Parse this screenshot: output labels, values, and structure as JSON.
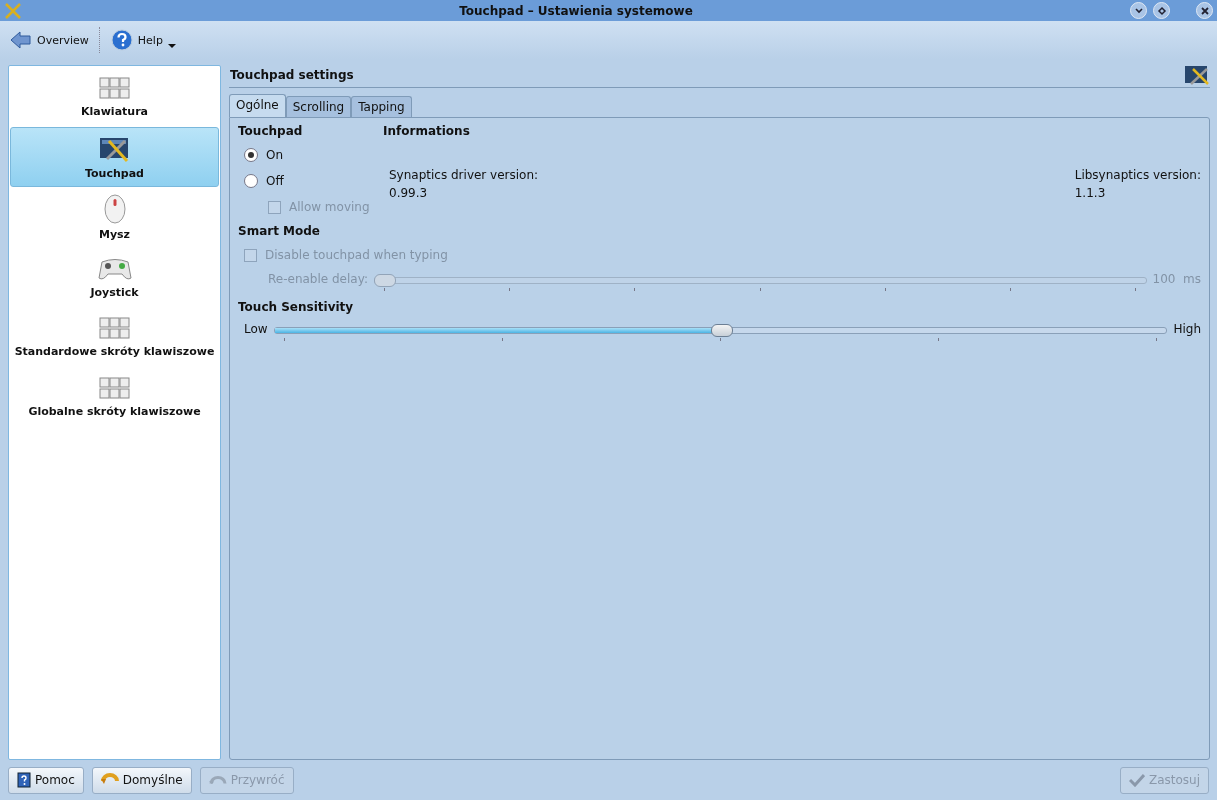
{
  "window": {
    "title": "Touchpad – Ustawienia systemowe"
  },
  "toolbar": [
    {
      "kind": "back",
      "label": "Overview"
    },
    {
      "kind": "help",
      "label": "Help",
      "menu": true
    }
  ],
  "sidebar": {
    "items": [
      {
        "kind": "keyboard",
        "label": "Klawiatura",
        "selected": false
      },
      {
        "kind": "touchpad",
        "label": "Touchpad",
        "selected": true
      },
      {
        "kind": "mouse",
        "label": "Mysz",
        "selected": false
      },
      {
        "kind": "joystick",
        "label": "Joystick",
        "selected": false
      },
      {
        "kind": "keyboard",
        "label": "Standardowe skróty klawiszowe",
        "selected": false
      },
      {
        "kind": "keyboard",
        "label": "Globalne skróty klawiszowe",
        "selected": false
      }
    ]
  },
  "header": {
    "title": "Touchpad settings"
  },
  "tabs": [
    {
      "label": "Ogólne",
      "selected": true
    },
    {
      "label": "Scrolling",
      "selected": false
    },
    {
      "label": "Tapping",
      "selected": false
    }
  ],
  "touchpad": {
    "title": "Touchpad",
    "options": [
      {
        "label": "On",
        "selected": true
      },
      {
        "label": "Off",
        "selected": false
      }
    ],
    "allow_moving": {
      "label": "Allow moving",
      "checked": false,
      "disabled": true
    }
  },
  "informations": {
    "title": "Informations",
    "items": [
      {
        "label": "Synaptics driver version:",
        "value": "0.99.3"
      },
      {
        "label": "Libsynaptics version:",
        "value": "1.1.3"
      }
    ]
  },
  "smart_mode": {
    "title": "Smart Mode",
    "checkbox": {
      "label": "Disable touchpad when typing",
      "checked": false,
      "disabled": true
    },
    "delay": {
      "label": "Re-enable delay:",
      "level": 0,
      "reading": "100  ms",
      "disabled": true
    }
  },
  "sensitivity": {
    "title": "Touch Sensitivity",
    "low": "Low",
    "high": "High",
    "level": 0.5
  },
  "buttons": [
    {
      "kind": "help",
      "label": "Pomoc",
      "disabled": false
    },
    {
      "kind": "defaults",
      "label": "Domyślne",
      "disabled": false
    },
    {
      "kind": "reset",
      "label": "Przywróć",
      "disabled": true
    }
  ],
  "apply": {
    "label": "Zastosuj",
    "disabled": true
  }
}
